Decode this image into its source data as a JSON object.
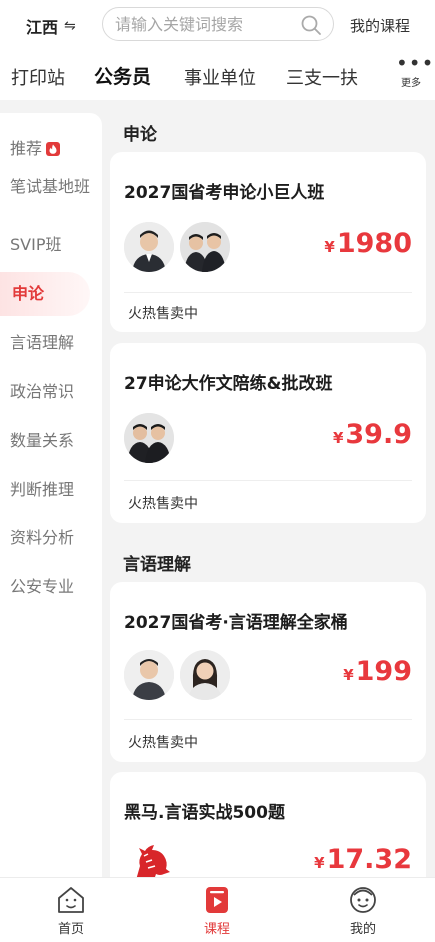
{
  "header": {
    "region": "江西",
    "region_switch_icon": "swap-arrows-icon",
    "search_placeholder": "请输入关键词搜索",
    "my_courses": "我的课程"
  },
  "categories": {
    "items": [
      "打印站",
      "公务员",
      "事业单位",
      "三支一扶"
    ],
    "active": "公务员",
    "more_label": "更多"
  },
  "sidebar": {
    "items": [
      "推荐",
      "笔试基地班",
      "SVIP班",
      "申论",
      "言语理解",
      "政治常识",
      "数量关系",
      "判断推理",
      "资料分析",
      "公安专业"
    ],
    "active": "申论"
  },
  "sections": [
    {
      "title": "申论",
      "cards": [
        {
          "title": "2027国省考申论小巨人班",
          "currency": "¥",
          "price": "1980",
          "status": "火热售卖中",
          "avatars": 2
        },
        {
          "title": "27申论大作文陪练&批改班",
          "currency": "¥",
          "price": "39.9",
          "status": "火热售卖中",
          "avatars": 1
        }
      ]
    },
    {
      "title": "言语理解",
      "cards": [
        {
          "title": "2027国省考·言语理解全家桶",
          "currency": "¥",
          "price": "199",
          "status": "火热售卖中",
          "avatars": 2
        },
        {
          "title": "黑马.言语实战500题",
          "currency": "¥",
          "price": "17.32",
          "avatars": 1
        }
      ]
    }
  ],
  "bottom_nav": {
    "items": [
      {
        "label": "首页",
        "icon": "home-icon"
      },
      {
        "label": "课程",
        "icon": "course-play-icon"
      },
      {
        "label": "我的",
        "icon": "profile-mascot-icon"
      }
    ],
    "active": "课程"
  },
  "colors": {
    "accent": "#e23a3a",
    "price": "#e8383d"
  }
}
